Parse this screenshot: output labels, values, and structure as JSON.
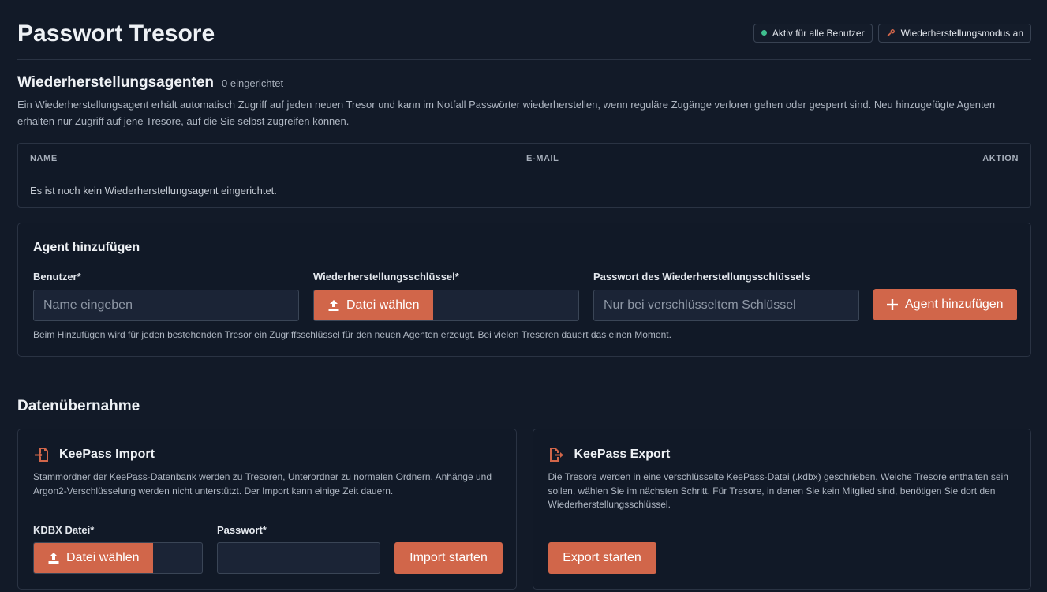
{
  "header": {
    "title": "Passwort Tresore",
    "badge_active": "Aktiv für alle Benutzer",
    "badge_recovery": "Wiederherstellungsmodus an"
  },
  "agents": {
    "title": "Wiederherstellungsagenten",
    "count": "0 eingerichtet",
    "description": "Ein Wiederherstellungsagent erhält automatisch Zugriff auf jeden neuen Tresor und kann im Notfall Passwörter wiederherstellen, wenn reguläre Zugänge verloren gehen oder gesperrt sind. Neu hinzugefügte Agenten erhalten nur Zugriff auf jene Tresore, auf die Sie selbst zugreifen können.",
    "table": {
      "col_name": "NAME",
      "col_email": "E-MAIL",
      "col_action": "AKTION",
      "empty": "Es ist noch kein Wiederherstellungsagent eingerichtet."
    }
  },
  "add_agent": {
    "title": "Agent hinzufügen",
    "user_label": "Benutzer*",
    "user_placeholder": "Name eingeben",
    "key_label": "Wiederherstellungsschlüssel*",
    "key_button": "Datei wählen",
    "password_label": "Passwort des Wiederherstellungsschlüssels",
    "password_placeholder": "Nur bei verschlüsseltem Schlüssel",
    "submit": "Agent hinzufügen",
    "hint": "Beim Hinzufügen wird für jeden bestehenden Tresor ein Zugriffsschlüssel für den neuen Agenten erzeugt. Bei vielen Tresoren dauert das einen Moment."
  },
  "migration": {
    "title": "Datenübernahme",
    "import": {
      "title": "KeePass Import",
      "description": "Stammordner der KeePass-Datenbank werden zu Tresoren, Unterordner zu normalen Ordnern. Anhänge und Argon2-Verschlüsselung werden nicht unterstützt. Der Import kann einige Zeit dauern.",
      "file_label": "KDBX Datei*",
      "file_button": "Datei wählen",
      "password_label": "Passwort*",
      "submit": "Import starten"
    },
    "export": {
      "title": "KeePass Export",
      "description": "Die Tresore werden in eine verschlüsselte KeePass-Datei (.kdbx) geschrieben. Welche Tresore enthalten sein sollen, wählen Sie im nächsten Schritt. Für Tresore, in denen Sie kein Mitglied sind, benötigen Sie dort den Wiederherstellungsschlüssel.",
      "submit": "Export starten"
    }
  },
  "colors": {
    "accent": "#d1664a",
    "background": "#121a28",
    "success": "#3fbf8f"
  }
}
